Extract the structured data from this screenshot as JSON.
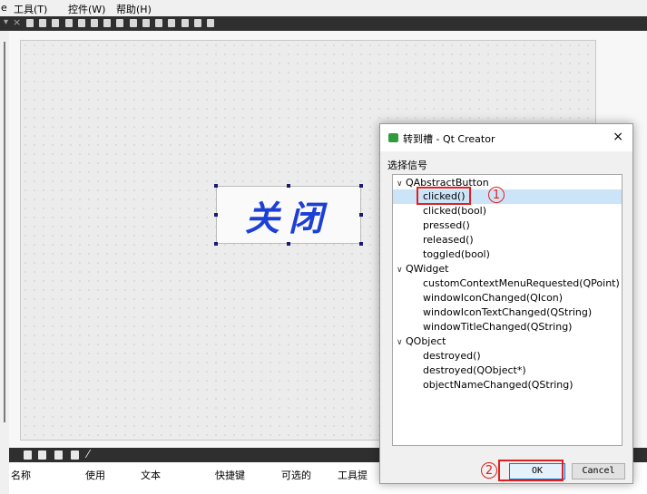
{
  "menubar": {
    "partial_left": "e",
    "items": [
      {
        "label": "工具(T)"
      },
      {
        "label": "控件(W)"
      },
      {
        "label": "帮助(H)"
      }
    ]
  },
  "form": {
    "button_text": "关闭"
  },
  "bottom_panel": {
    "columns": [
      "名称",
      "使用",
      "文本",
      "快捷键",
      "可选的",
      "工具提"
    ]
  },
  "dialog": {
    "title": "转到槽 - Qt Creator",
    "close_icon": "×",
    "group_label": "选择信号",
    "tree": [
      {
        "label": "QAbstractButton",
        "level": 0,
        "expanded": true
      },
      {
        "label": "clicked()",
        "level": 1,
        "selected": true
      },
      {
        "label": "clicked(bool)",
        "level": 1
      },
      {
        "label": "pressed()",
        "level": 1
      },
      {
        "label": "released()",
        "level": 1
      },
      {
        "label": "toggled(bool)",
        "level": 1
      },
      {
        "label": "QWidget",
        "level": 0,
        "expanded": true
      },
      {
        "label": "customContextMenuRequested(QPoint)",
        "level": 1
      },
      {
        "label": "windowIconChanged(QIcon)",
        "level": 1
      },
      {
        "label": "windowIconTextChanged(QString)",
        "level": 1
      },
      {
        "label": "windowTitleChanged(QString)",
        "level": 1
      },
      {
        "label": "QObject",
        "level": 0,
        "expanded": true
      },
      {
        "label": "destroyed()",
        "level": 1
      },
      {
        "label": "destroyed(QObject*)",
        "level": 1
      },
      {
        "label": "objectNameChanged(QString)",
        "level": 1
      }
    ],
    "ok_label": "OK",
    "cancel_label": "Cancel"
  },
  "annotations": {
    "step1": "1",
    "step2": "2"
  },
  "colors": {
    "accent_red": "#e02020",
    "button_text_blue": "#1c3fd6",
    "selection": "#cce4f7",
    "dark_toolbar": "#2f2f2f"
  },
  "icons": [
    "close-icon",
    "qt-creator-icon",
    "chevron-down-icon",
    "toolbar-icon"
  ]
}
